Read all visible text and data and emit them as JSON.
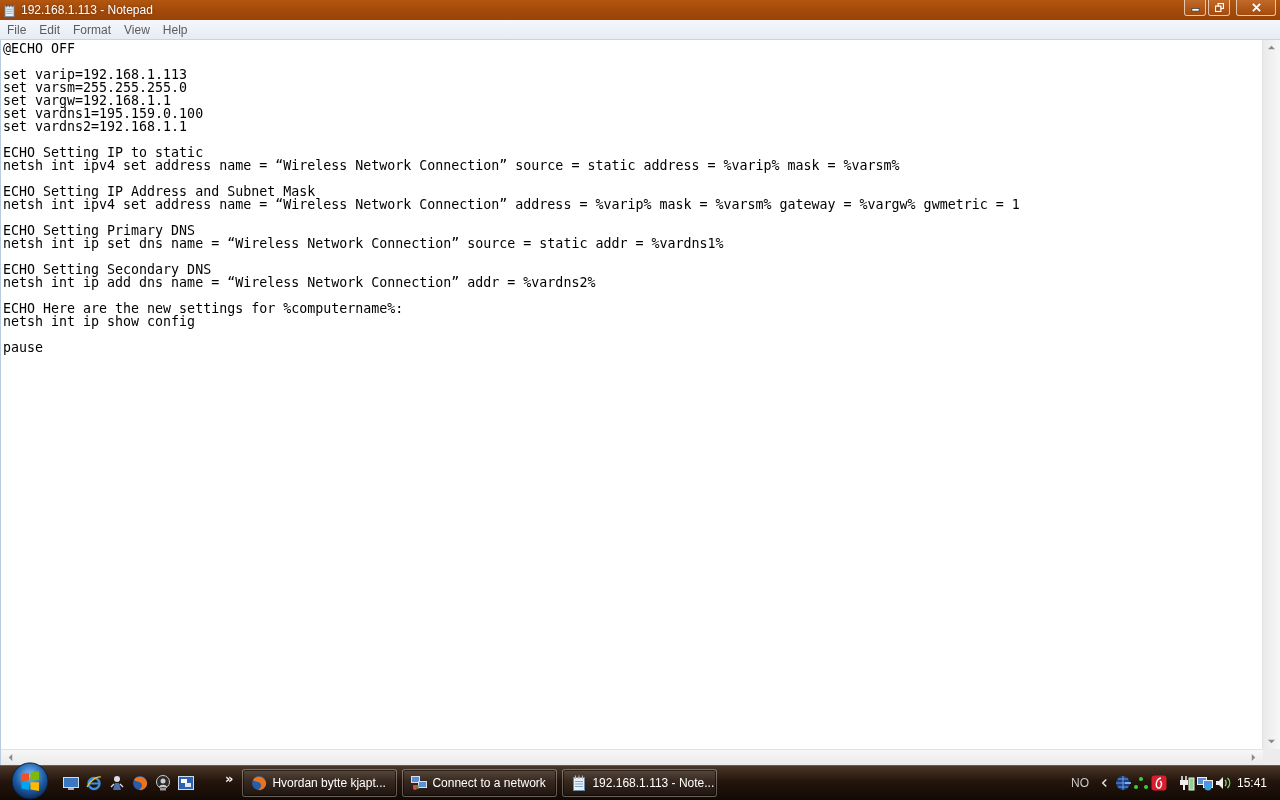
{
  "window": {
    "title": "192.168.1.113 - Notepad"
  },
  "menu_bar": {
    "items": [
      "File",
      "Edit",
      "Format",
      "View",
      "Help"
    ]
  },
  "editor": {
    "blocks": [
      [
        "@ECHO OFF"
      ],
      [
        "set varip=192.168.1.113",
        "set varsm=255.255.255.0",
        "set vargw=192.168.1.1",
        "set vardns1=195.159.0.100",
        "set vardns2=192.168.1.1"
      ],
      [
        "ECHO Setting IP to static",
        "netsh int ipv4 set address name = “Wireless Network Connection” source = static address = %varip% mask = %varsm%"
      ],
      [
        "ECHO Setting IP Address and Subnet Mask",
        "netsh int ipv4 set address name = “Wireless Network Connection” address = %varip% mask = %varsm% gateway = %vargw% gwmetric = 1"
      ],
      [
        "ECHO Setting Primary DNS",
        "netsh int ip set dns name = “Wireless Network Connection” source = static addr = %vardns1%"
      ],
      [
        "ECHO Setting Secondary DNS",
        "netsh int ip add dns name = “Wireless Network Connection” addr = %vardns2%"
      ],
      [
        "ECHO Here are the new settings for %computername%:",
        "netsh int ip show config"
      ],
      [
        "pause"
      ]
    ]
  },
  "taskbar": {
    "quick_launch_overflow": "»",
    "tasks": [
      {
        "kind": "browser",
        "label": "Hvordan bytte kjapt..."
      },
      {
        "kind": "network",
        "label": "Connect to a network"
      },
      {
        "kind": "notepad",
        "label": "192.168.1.113 - Note..."
      }
    ]
  },
  "tray": {
    "language": "NO",
    "clock": "15:41"
  }
}
